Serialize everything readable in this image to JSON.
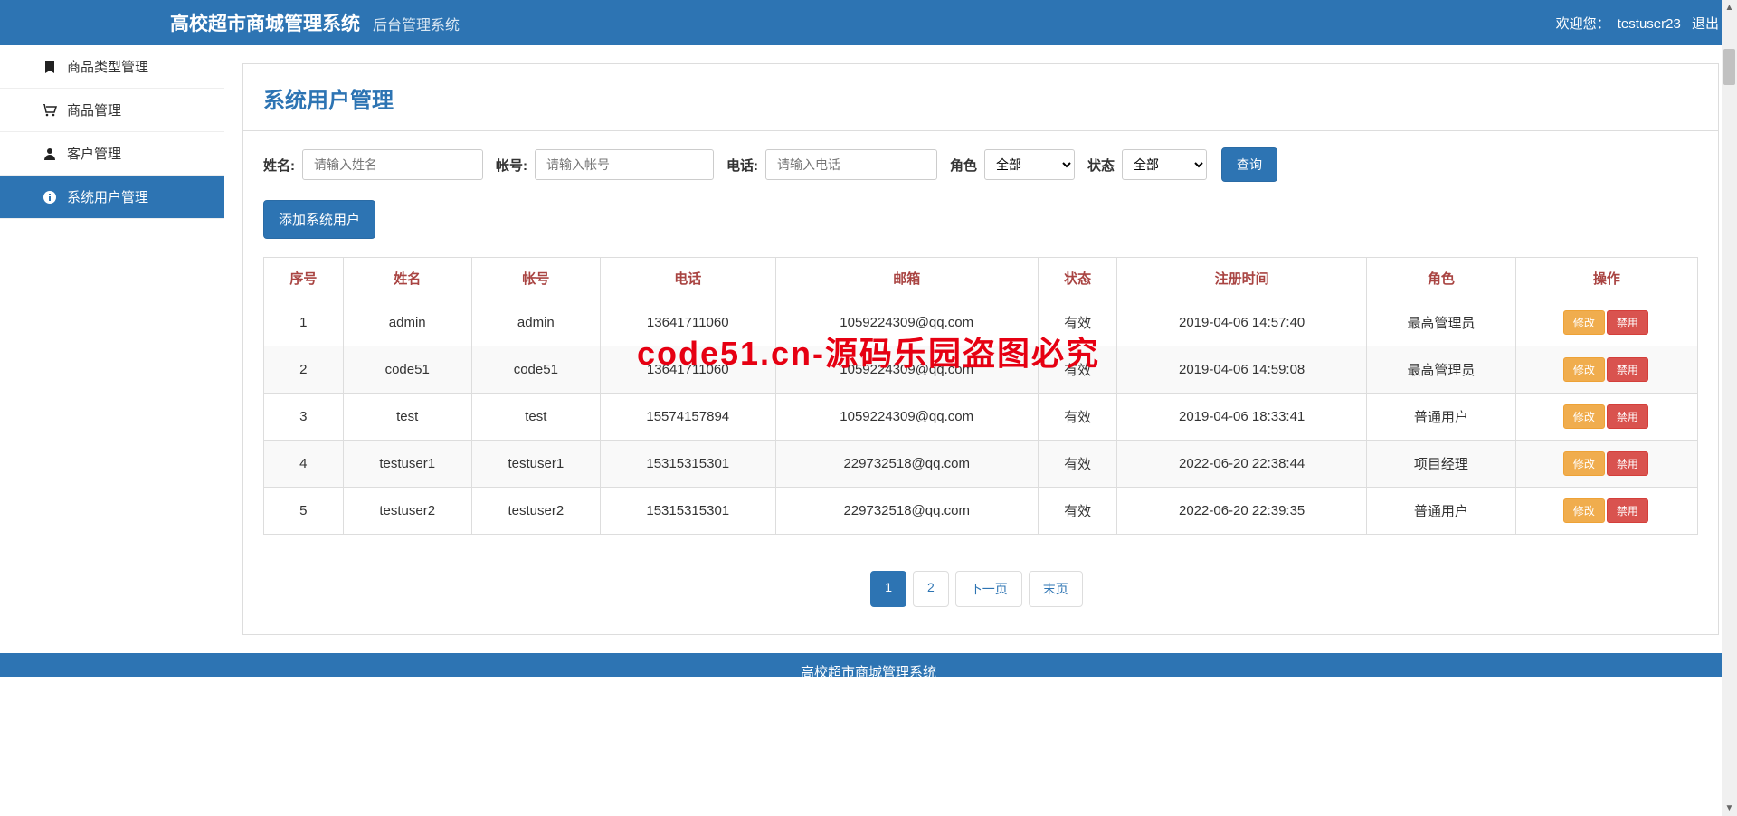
{
  "header": {
    "brand_main": "高校超市商城管理系统",
    "brand_sub": "后台管理系统",
    "welcome": "欢迎您：",
    "username": "testuser23",
    "logout": "退出"
  },
  "sidebar": {
    "items": [
      {
        "label": "商品类型管理",
        "icon": "bookmark-icon"
      },
      {
        "label": "商品管理",
        "icon": "cart-icon"
      },
      {
        "label": "客户管理",
        "icon": "user-icon"
      },
      {
        "label": "系统用户管理",
        "icon": "info-icon"
      }
    ]
  },
  "page": {
    "title": "系统用户管理"
  },
  "filters": {
    "name_label": "姓名:",
    "name_placeholder": "请输入姓名",
    "account_label": "帐号:",
    "account_placeholder": "请输入帐号",
    "phone_label": "电话:",
    "phone_placeholder": "请输入电话",
    "role_label": "角色",
    "role_selected": "全部",
    "status_label": "状态",
    "status_selected": "全部",
    "query_btn": "查询"
  },
  "actions": {
    "add_user": "添加系统用户",
    "edit": "修改",
    "disable": "禁用"
  },
  "table": {
    "headers": [
      "序号",
      "姓名",
      "帐号",
      "电话",
      "邮箱",
      "状态",
      "注册时间",
      "角色",
      "操作"
    ],
    "rows": [
      {
        "idx": "1",
        "name": "admin",
        "account": "admin",
        "phone": "13641711060",
        "email": "1059224309@qq.com",
        "status": "有效",
        "regtime": "2019-04-06 14:57:40",
        "role": "最高管理员"
      },
      {
        "idx": "2",
        "name": "code51",
        "account": "code51",
        "phone": "13641711060",
        "email": "1059224309@qq.com",
        "status": "有效",
        "regtime": "2019-04-06 14:59:08",
        "role": "最高管理员"
      },
      {
        "idx": "3",
        "name": "test",
        "account": "test",
        "phone": "15574157894",
        "email": "1059224309@qq.com",
        "status": "有效",
        "regtime": "2019-04-06 18:33:41",
        "role": "普通用户"
      },
      {
        "idx": "4",
        "name": "testuser1",
        "account": "testuser1",
        "phone": "15315315301",
        "email": "229732518@qq.com",
        "status": "有效",
        "regtime": "2022-06-20 22:38:44",
        "role": "项目经理"
      },
      {
        "idx": "5",
        "name": "testuser2",
        "account": "testuser2",
        "phone": "15315315301",
        "email": "229732518@qq.com",
        "status": "有效",
        "regtime": "2022-06-20 22:39:35",
        "role": "普通用户"
      }
    ]
  },
  "pagination": {
    "pages": [
      "1",
      "2"
    ],
    "next": "下一页",
    "last": "末页"
  },
  "footer": {
    "text": "高校超市商城管理系统"
  },
  "watermark": "code51.cn-源码乐园盗图必究"
}
